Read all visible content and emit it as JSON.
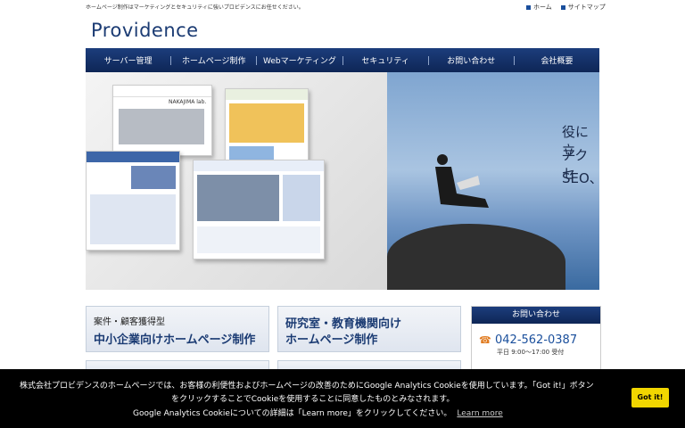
{
  "header": {
    "tagline": "ホームページ制作はマーケティングとセキュリティに強いプロビデンスにお任せください。",
    "links": [
      "ホーム",
      "サイトマップ"
    ],
    "logo": "Providence"
  },
  "nav": {
    "items": [
      "サーバー管理",
      "ホームページ制作",
      "Webマーケティング",
      "セキュリティ",
      "お問い合わせ",
      "会社概要"
    ]
  },
  "hero": {
    "text": [
      "役に立",
      "アクセ",
      "SEO、"
    ],
    "samples": [
      "NAKAJIMA lab."
    ]
  },
  "services": {
    "card1": {
      "small": "案件・顧客獲得型",
      "big": "中小企業向けホームページ制作"
    },
    "card2": {
      "big1": "研究室・教育機関向け",
      "big2": "ホームページ制作"
    }
  },
  "contact": {
    "title": "お問い合わせ",
    "phone": "042-562-0387",
    "hours": "平日 9:00～17:00 受付"
  },
  "cookie": {
    "line1": "株式会社プロビデンスのホームページでは、お客様の利便性およびホームページの改善のためにGoogle Analytics Cookieを使用しています。「Got it!」ボタン",
    "line2": "をクリックすることでCookieを使用することに同意したものとみなされます。",
    "line3": "Google Analytics Cookieについての詳細は「Learn more」をクリックしてください。",
    "learn_more": "Learn more",
    "button": "Got it!"
  },
  "colors": {
    "nav_bg": "#0e2656",
    "accent": "#1a4f9c",
    "cookie_button": "#f1d600"
  }
}
